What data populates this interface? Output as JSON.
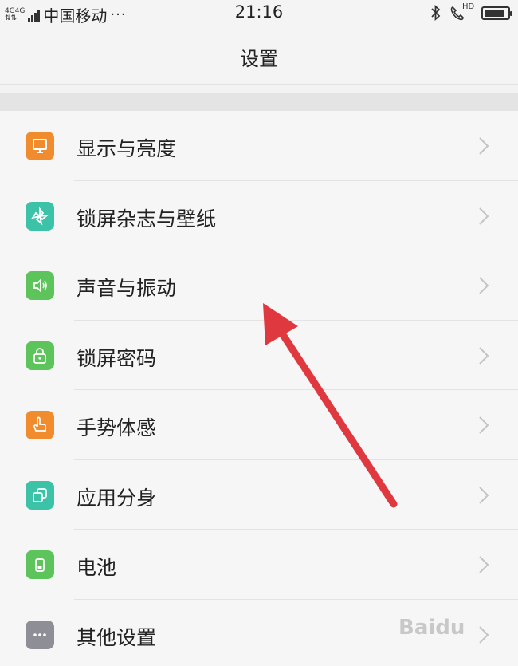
{
  "status_bar": {
    "network_tag_top": "4G4G",
    "network_tag_bottom": "⇅⇅",
    "carrier": "中国移动",
    "more_dots": "···",
    "time": "21:16",
    "hd_label": "HD",
    "battery_level": 0.88
  },
  "nav": {
    "title": "设置"
  },
  "settings": {
    "items": [
      {
        "label": "显示与亮度",
        "icon": "display-icon",
        "color": "#f08c2e"
      },
      {
        "label": "锁屏杂志与壁纸",
        "icon": "pinwheel-icon",
        "color": "#3cc2a6"
      },
      {
        "label": "声音与振动",
        "icon": "speaker-icon",
        "color": "#5cc45a"
      },
      {
        "label": "锁屏密码",
        "icon": "lock-icon",
        "color": "#5cc45a"
      },
      {
        "label": "手势体感",
        "icon": "hand-gesture-icon",
        "color": "#f08c2e"
      },
      {
        "label": "应用分身",
        "icon": "app-clone-icon",
        "color": "#3cc2a6"
      },
      {
        "label": "电池",
        "icon": "battery-icon",
        "color": "#5cc45a"
      },
      {
        "label": "其他设置",
        "icon": "more-icon",
        "color": "#8e8e96"
      }
    ]
  },
  "overlay": {
    "arrow_color": "#e0383f"
  },
  "watermark": {
    "text": "Baidu"
  }
}
